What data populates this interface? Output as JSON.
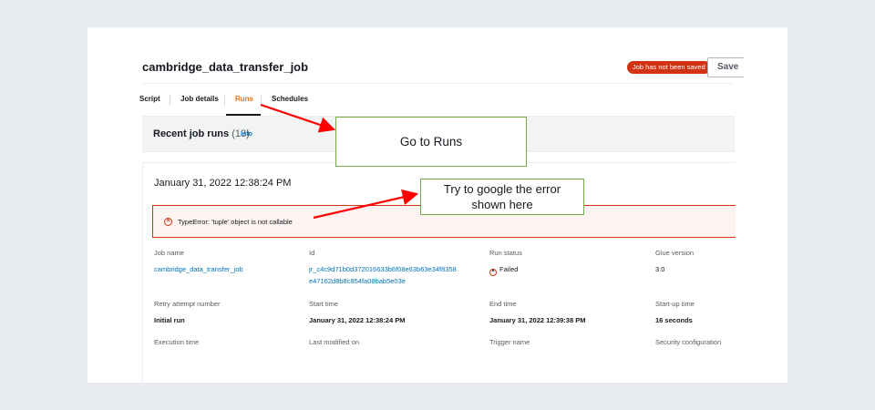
{
  "header": {
    "job_title": "cambridge_data_transfer_job",
    "unsaved_badge": "Job has not been saved",
    "save_label": "Save"
  },
  "tabs": [
    {
      "label": "Script",
      "active": false
    },
    {
      "label": "Job details",
      "active": false
    },
    {
      "label": "Runs",
      "active": true
    },
    {
      "label": "Schedules",
      "active": false
    }
  ],
  "runs": {
    "title": "Recent job runs",
    "count": "(13)",
    "info_label": "Info"
  },
  "run": {
    "date": "January 31, 2022 12:38:24 PM",
    "error_icon": "error-circle-icon",
    "error_message": "TypeError: 'tuple' object is not callable",
    "fields": {
      "job_name_label": "Job name",
      "job_name_value": "cambridge_data_transfer_job",
      "id_label": "Id",
      "id_value_line1": "jr_c4c9d71b0d372016633b6f08e63b63e34f8358",
      "id_value_line2": "e47162d8b8c854fa08bab5e03e",
      "run_status_label": "Run status",
      "run_status_value": "Failed",
      "glue_version_label": "Glue version",
      "glue_version_value": "3.0",
      "retry_label": "Retry attempt number",
      "retry_value": "Initial run",
      "start_time_label": "Start time",
      "start_time_value": "January 31, 2022 12:38:24 PM",
      "end_time_label": "End time",
      "end_time_value": "January 31, 2022 12:39:38 PM",
      "startup_time_label": "Start-up time",
      "startup_time_value": "16 seconds",
      "execution_time_label": "Execution time",
      "last_modified_label": "Last modified on",
      "trigger_name_label": "Trigger name",
      "security_config_label": "Security configuration"
    }
  },
  "annotations": {
    "callout_runs": "Go to Runs",
    "callout_google_line1": "Try to google the error",
    "callout_google_line2": "shown here",
    "arrow_color": "#ff0000",
    "callout_border_color": "#70ad47"
  },
  "colors": {
    "accent_tab": "#ec7211",
    "link": "#0073bb",
    "error": "#d13212"
  }
}
